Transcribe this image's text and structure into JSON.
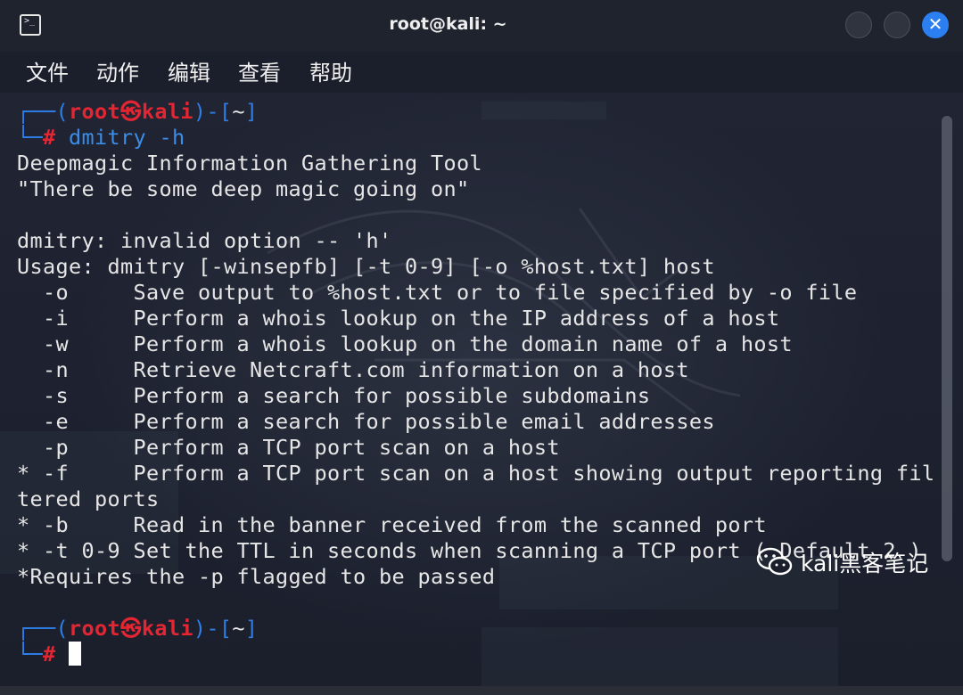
{
  "window": {
    "title": "root@kali: ~",
    "terminal_icon": "terminal-icon"
  },
  "menu": {
    "items": [
      "文件",
      "动作",
      "编辑",
      "查看",
      "帮助"
    ]
  },
  "prompt": {
    "open": "┌──(",
    "user": "root",
    "skull": "㉿",
    "host": "kali",
    "close": ")-[",
    "dir": "~",
    "end": "]",
    "corner": "└─",
    "hash": "#"
  },
  "command": "dmitry -h",
  "output": [
    "Deepmagic Information Gathering Tool",
    "\"There be some deep magic going on\"",
    "",
    "dmitry: invalid option -- 'h'",
    "Usage: dmitry [-winsepfb] [-t 0-9] [-o %host.txt] host",
    "  -o     Save output to %host.txt or to file specified by -o file",
    "  -i     Perform a whois lookup on the IP address of a host",
    "  -w     Perform a whois lookup on the domain name of a host",
    "  -n     Retrieve Netcraft.com information on a host",
    "  -s     Perform a search for possible subdomains",
    "  -e     Perform a search for possible email addresses",
    "  -p     Perform a TCP port scan on a host",
    "* -f     Perform a TCP port scan on a host showing output reporting fil",
    "tered ports",
    "* -b     Read in the banner received from the scanned port",
    "* -t 0-9 Set the TTL in seconds when scanning a TCP port ( Default 2 )",
    "*Requires the -p flagged to be passed"
  ],
  "watermark": {
    "text": "kali黑客笔记",
    "icon": "wechat-icon"
  },
  "colors": {
    "prompt_frame": "#2e7ee8",
    "prompt_user": "#e42532",
    "text": "#e6e6e6",
    "close_button": "#2b7ff0"
  }
}
